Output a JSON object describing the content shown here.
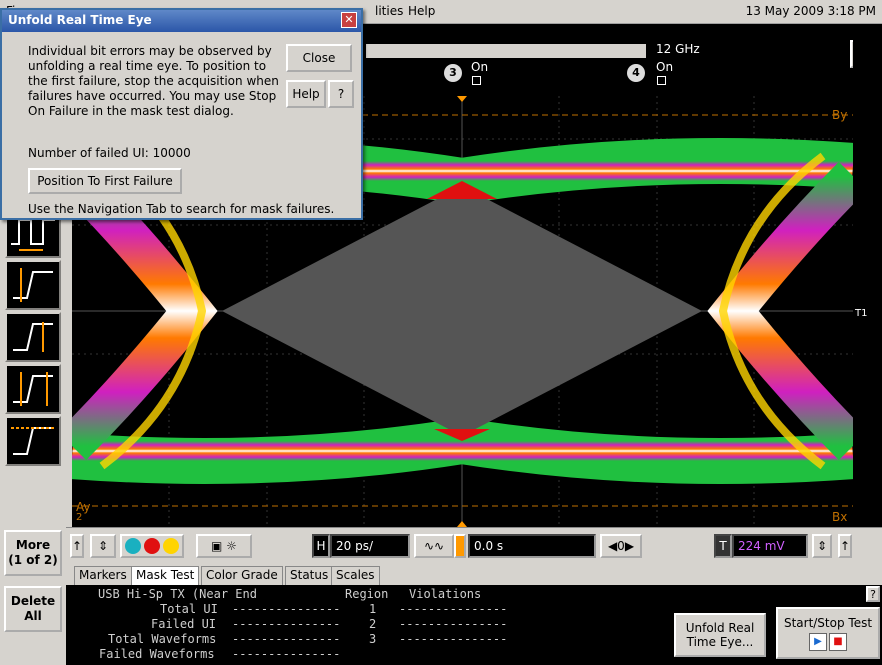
{
  "menubar": {
    "file": "Fi",
    "utilities": "lities",
    "help": "Help",
    "datetime": "13 May 2009  3:18 PM"
  },
  "dialog": {
    "title": "Unfold Real Time Eye",
    "message": "Individual bit errors may be observed by unfolding a real time eye. To position to the first failure, stop the acquisition when failures have occurred. You may use Stop On Failure in the mask test dialog.",
    "failed_ui": "Number of failed UI: 10000",
    "close": "Close",
    "help": "Help",
    "help_pointer": "?",
    "position_btn": "Position To First Failure",
    "nav_hint": "Use the Navigation Tab to search for mask failures."
  },
  "topstrip": {
    "bandwidth": "12 GHz",
    "ch3": "3",
    "ch3_on": "On",
    "ch4": "4",
    "ch4_on": "On",
    "minus": "—"
  },
  "scope": {
    "marker_by": "By",
    "marker_ay": "Ay",
    "marker_bx": "Bx",
    "marker_ay_sub": "2",
    "trigger": "T1"
  },
  "controls": {
    "h_label": "H",
    "timebase": "20 ps/",
    "trig_pos": "0.0 s",
    "zoom_val": "0",
    "t_label": "T",
    "trig_level": "224 mV"
  },
  "leftbar": {
    "more": "More",
    "more_sub": "(1 of 2)",
    "delete": "Delete",
    "delete_sub": "All"
  },
  "tabs": [
    "Markers",
    "Mask Test",
    "Color Grade",
    "Status",
    "Scales"
  ],
  "mask_panel": {
    "header": "USB Hi-Sp TX (Near End",
    "region_header": "Region",
    "violations_header": "Violations",
    "rows": [
      {
        "label": "Total UI",
        "dashes": "---------------",
        "region": "1",
        "vdash": "---------------"
      },
      {
        "label": "Failed UI",
        "dashes": "---------------",
        "region": "2",
        "vdash": "---------------"
      },
      {
        "label": "Total Waveforms",
        "dashes": "---------------",
        "region": "3",
        "vdash": "---------------"
      },
      {
        "label": "Failed Waveforms",
        "dashes": "---------------",
        "region": "",
        "vdash": ""
      }
    ]
  },
  "buttons": {
    "unfold": "Unfold Real\nTime Eye...",
    "startstop": "Start/Stop Test",
    "question": "?"
  },
  "colors": {
    "accent": "#2b56a8",
    "eye_white": "#ffffff",
    "eye_yellow": "#ffd400",
    "eye_orange": "#ff7a00",
    "eye_red": "#e01010",
    "eye_magenta": "#d020c0",
    "eye_blue": "#2060ff",
    "eye_green": "#20c040",
    "mask": "#555555"
  }
}
